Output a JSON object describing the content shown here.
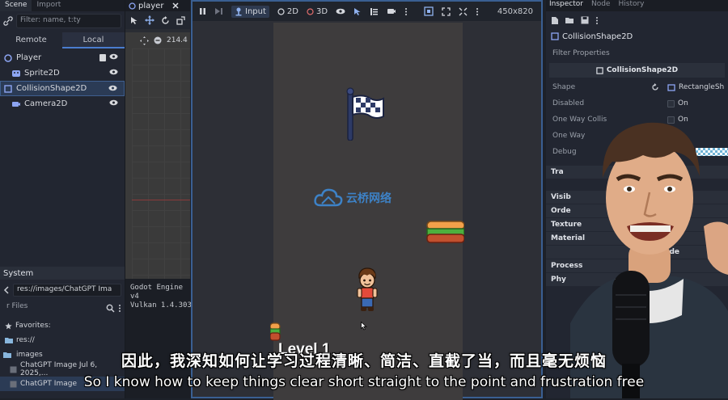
{
  "scene_dock": {
    "tabs": [
      "Scene",
      "Import"
    ],
    "filter_placeholder": "Filter: name, t:ty",
    "remote_tab": "Remote",
    "local_tab": "Local",
    "nodes": [
      {
        "label": "Player",
        "icon": "node-icon"
      },
      {
        "label": "Sprite2D",
        "icon": "sprite-icon"
      },
      {
        "label": "CollisionShape2D",
        "icon": "collision-icon"
      },
      {
        "label": "Camera2D",
        "icon": "camera-icon"
      }
    ]
  },
  "filesystem": {
    "title": "System",
    "path": "res://images/ChatGPT Ima",
    "filter_placeholder": "r Files",
    "favorites": "Favorites:",
    "res": "res://",
    "images": "images",
    "file1": "ChatGPT Image Jul 6, 2025,...",
    "file2": "ChatGPT Image"
  },
  "editor": {
    "tab_label": "player",
    "zoom": "214.4"
  },
  "output": {
    "line1": "Godot Engine v4",
    "line2": "Vulkan 1.4.303"
  },
  "game_toolbar": {
    "input_label": "Input",
    "mode_2d": "2D",
    "mode_3d": "3D",
    "resolution": "450x820"
  },
  "game_scene": {
    "level_text": "Level 1"
  },
  "watermark": {
    "text": "云桥网络"
  },
  "inspector": {
    "tabs": [
      "Inspector",
      "Node",
      "History"
    ],
    "node_name": "CollisionShape2D",
    "filter_placeholder": "Filter Properties",
    "class_name": "CollisionShape2D",
    "props": [
      {
        "label": "Shape",
        "value": "RectangleSh"
      },
      {
        "label": "Disabled",
        "value": "On"
      },
      {
        "label": "One Way Collis",
        "value": "On"
      },
      {
        "label": "One Way",
        "value": ""
      },
      {
        "label": "Debug",
        "value": ""
      }
    ],
    "sections": [
      "Tra",
      "Visib",
      "Orde",
      "Texture",
      "Material",
      "Process",
      "Phy"
    ],
    "node_section": "ode"
  },
  "subtitles": {
    "cn": "因此，我深知如何让学习过程清晰、简洁、直截了当，而且毫无烦恼",
    "en": "So I know how to keep things clear short straight to the point and frustration free"
  },
  "colors": {
    "accent": "#4a7ccf",
    "panel": "#222631",
    "viewport": "#3e3c3d"
  }
}
